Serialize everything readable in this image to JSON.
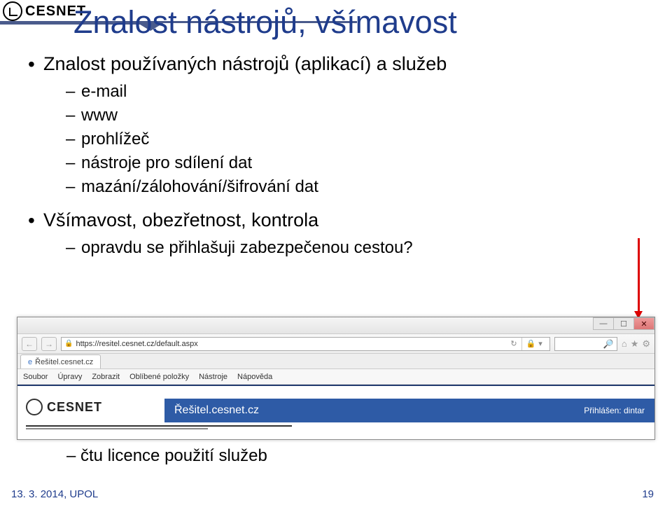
{
  "logo": {
    "text": "CESNET"
  },
  "title": "Znalost nástrojů, všímavost",
  "bullets": {
    "b1": "Znalost používaných nástrojů (aplikací) a služeb",
    "b1a": "e-mail",
    "b1b": "www",
    "b1c": "prohlížeč",
    "b1d": "nástroje pro sdílení dat",
    "b1e": "mazání/zálohování/šifrování dat",
    "b2": "Všímavost, obezřetnost, kontrola",
    "b2a": "opravdu se přihlašuji zabezpečenou cestou?",
    "b2f": "čtu licence použití služeb"
  },
  "browser": {
    "url": "https://resitel.cesnet.cz/default.aspx",
    "search_hint": "🔍",
    "refresh": "↻",
    "lock_label": "🔒",
    "cert_lock": "🔒",
    "magnify": "🔎",
    "star": "★",
    "gear": "⚙",
    "tab_title": "Řešitel.cesnet.cz",
    "menu": {
      "m1": "Soubor",
      "m2": "Úpravy",
      "m3": "Zobrazit",
      "m4": "Oblíbené položky",
      "m5": "Nástroje",
      "m6": "Nápověda"
    },
    "page_logo_text": "CESNET",
    "band_title": "Řešitel.cesnet.cz",
    "logged_in": "Přihlášen: dintar",
    "win": {
      "min": "—",
      "max": "☐",
      "close": "✕"
    },
    "nav": {
      "back": "←",
      "fwd": "→"
    }
  },
  "footer": {
    "left": "13. 3. 2014, UPOL",
    "right": "19"
  }
}
